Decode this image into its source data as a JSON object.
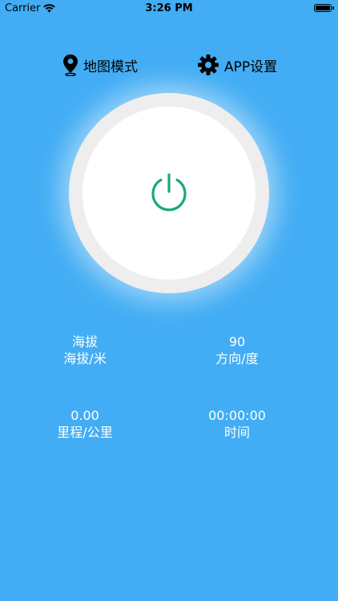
{
  "status_bar": {
    "carrier": "Carrier",
    "time": "3:26 PM"
  },
  "toolbar": {
    "map_mode_label": "地图模式",
    "app_settings_label": "APP设置"
  },
  "power_button": {
    "icon": "power-icon",
    "color": "#1aa87a"
  },
  "stats": {
    "altitude": {
      "value": "海拔",
      "label": "海拔/米"
    },
    "direction": {
      "value": "90",
      "label": "方向/度"
    },
    "distance": {
      "value": "0.00",
      "label": "里程/公里"
    },
    "duration": {
      "value": "00:00:00",
      "label": "时间"
    }
  },
  "colors": {
    "background": "#42adf4",
    "ring": "#eeeeee",
    "accent": "#1aa87a"
  }
}
